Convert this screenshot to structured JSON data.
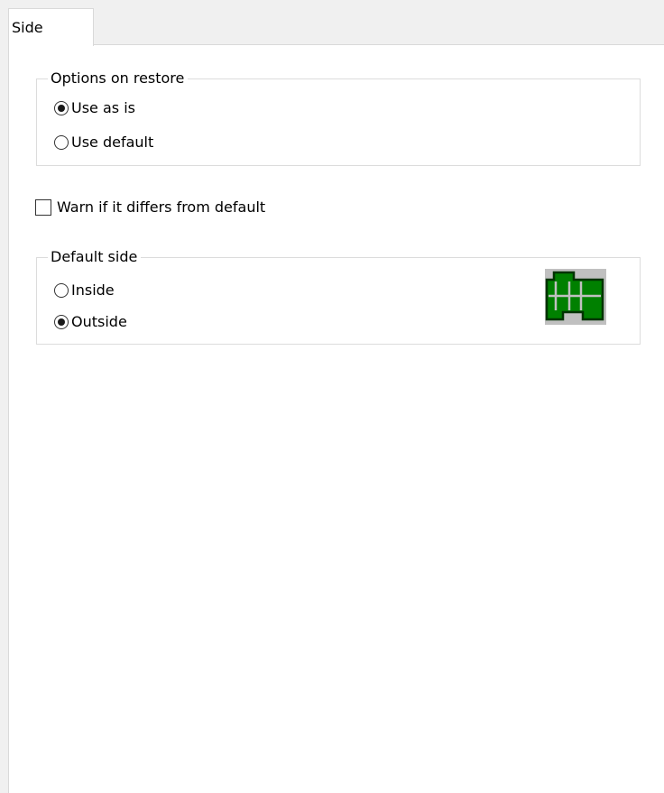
{
  "tabs": [
    {
      "label": "Side",
      "active": true
    }
  ],
  "restore_group": {
    "title": "Options on restore",
    "options": [
      {
        "label": "Use as is",
        "selected": true
      },
      {
        "label": "Use default",
        "selected": false
      }
    ]
  },
  "warn_checkbox": {
    "label": "Warn if it differs from default",
    "checked": false
  },
  "default_side_group": {
    "title": "Default side",
    "options": [
      {
        "label": "Inside",
        "selected": false
      },
      {
        "label": "Outside",
        "selected": true
      }
    ],
    "image_icon": "outside-side-icon"
  },
  "colors": {
    "icon_green": "#008000",
    "icon_bg": "#c0c0c0"
  }
}
